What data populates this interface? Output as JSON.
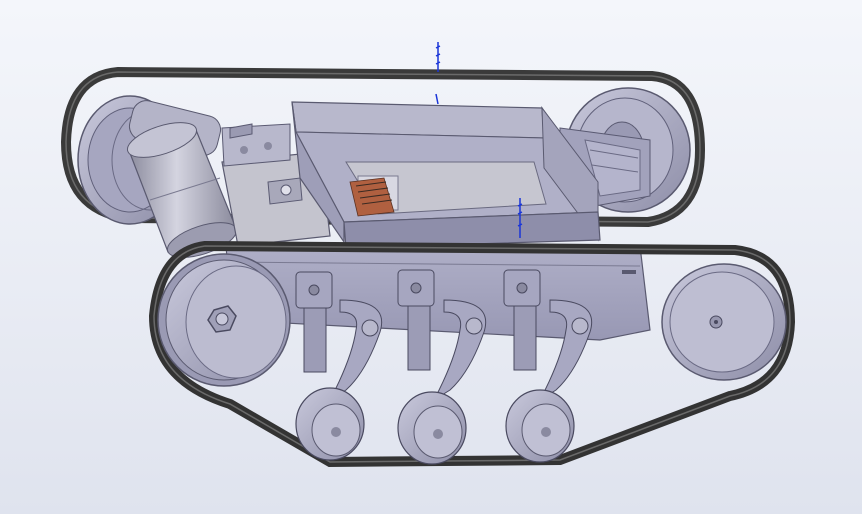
{
  "viewport": {
    "background_top": "#f4f6fb",
    "background_bottom": "#dfe3ee"
  },
  "model": {
    "body_color": "#a9a9c3",
    "body_dark": "#7f7f9b",
    "track_color": "#3a3a3a",
    "motor_color": "#b8b8c8",
    "board_color": "#c8c8d2",
    "connector_color": "#b06040",
    "axis_color": "#1a35d8"
  }
}
